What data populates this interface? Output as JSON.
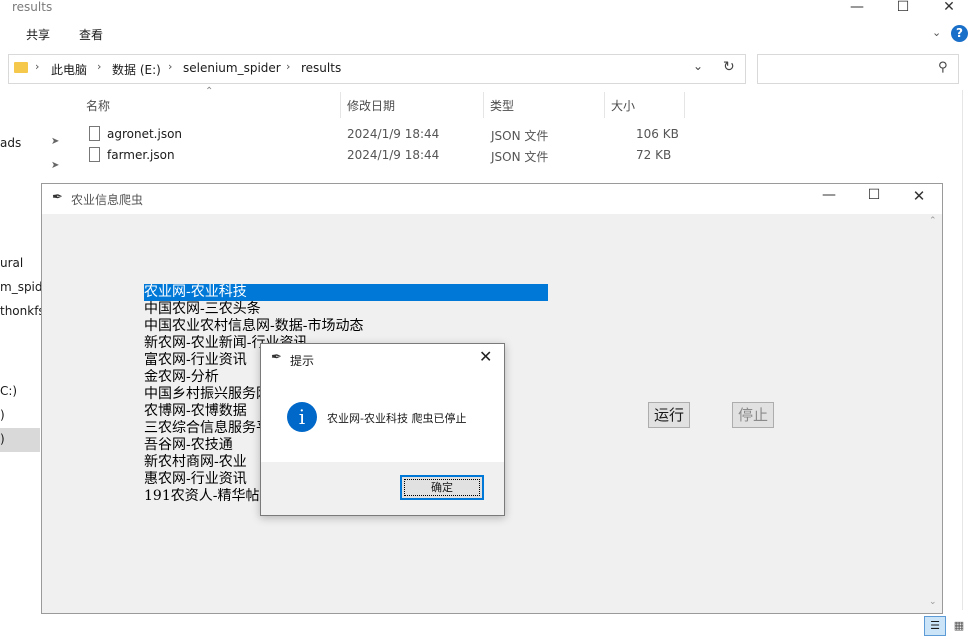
{
  "explorer": {
    "window_title": "results",
    "ribbon": {
      "tabs": [
        "共享",
        "查看"
      ]
    },
    "breadcrumb": [
      "此电脑",
      "数据 (E:)",
      "selenium_spider",
      "results"
    ],
    "search_placeholder": "",
    "columns": {
      "name": "名称",
      "date": "修改日期",
      "type": "类型",
      "size": "大小"
    },
    "files": [
      {
        "name": "agronet.json",
        "date": "2024/1/9 18:44",
        "type": "JSON 文件",
        "size": "106 KB"
      },
      {
        "name": "farmer.json",
        "date": "2024/1/9 18:44",
        "type": "JSON 文件",
        "size": "72 KB"
      }
    ],
    "sidebar_fragments": [
      "ads",
      "ural",
      "m_spide",
      "thonkfs",
      "C:)",
      ")",
      ")"
    ]
  },
  "app": {
    "title": "农业信息爬虫",
    "list": [
      "农业网-农业科技",
      "中国农网-三农头条",
      "中国农业农村信息网-数据-市场动态",
      "新农网-农业新闻-行业资讯",
      "富农网-行业资讯",
      "金农网-分析",
      "中国乡村振兴服务网",
      "农博网-农博数据",
      "三农综合信息服务平台",
      "吾谷网-农技通",
      "新农村商网-农业",
      "惠农网-行业资讯",
      "191农资人-精华帖"
    ],
    "selected_index": 0,
    "run_label": "运行",
    "stop_label": "停止"
  },
  "dialog": {
    "title": "提示",
    "message": "农业网-农业科技 爬虫已停止",
    "ok_label": "确定",
    "info_symbol": "i"
  },
  "colors": {
    "selection": "#0078d7",
    "info_icon": "#0068c8"
  }
}
